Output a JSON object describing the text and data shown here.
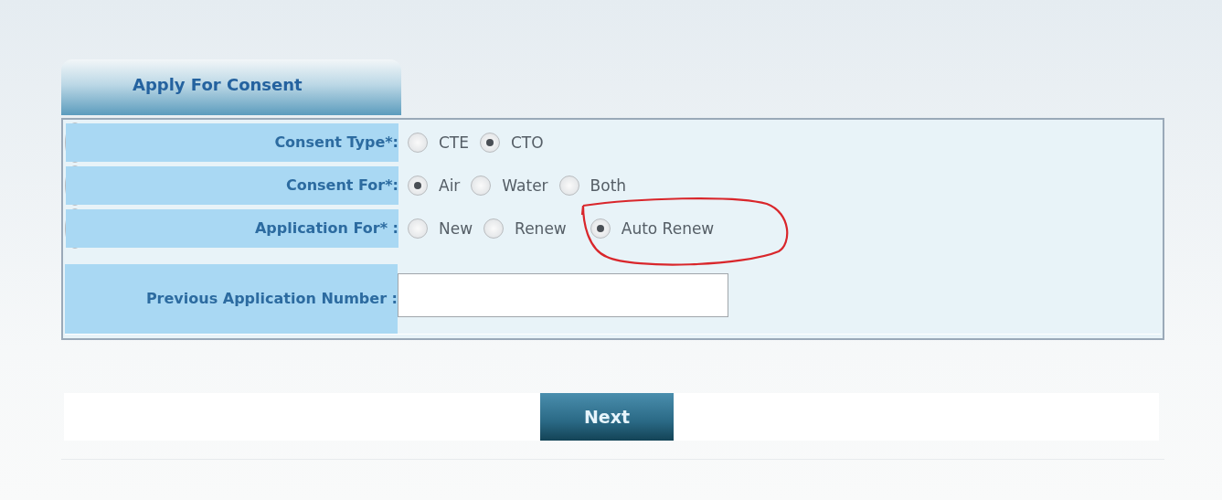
{
  "tab": {
    "label": "Apply For Consent",
    "selected": true
  },
  "fields": [
    {
      "kind": "radio",
      "label": "Consent Type*:",
      "options": [
        {
          "label": "CTE",
          "selected": false
        },
        {
          "label": "CTO",
          "selected": true
        }
      ]
    },
    {
      "kind": "radio",
      "label": "Consent For*:",
      "options": [
        {
          "label": "Air",
          "selected": true
        },
        {
          "label": "Water",
          "selected": false
        },
        {
          "label": "Both",
          "selected": false
        }
      ]
    },
    {
      "kind": "radio",
      "label": "Application For* :",
      "options": [
        {
          "label": "New",
          "selected": false
        },
        {
          "label": "Renew",
          "selected": false
        },
        {
          "label": "Auto Renew",
          "selected": true
        }
      ]
    },
    {
      "kind": "text",
      "label": "Previous Application Number :"
    }
  ],
  "buttons": [
    "Next"
  ]
}
